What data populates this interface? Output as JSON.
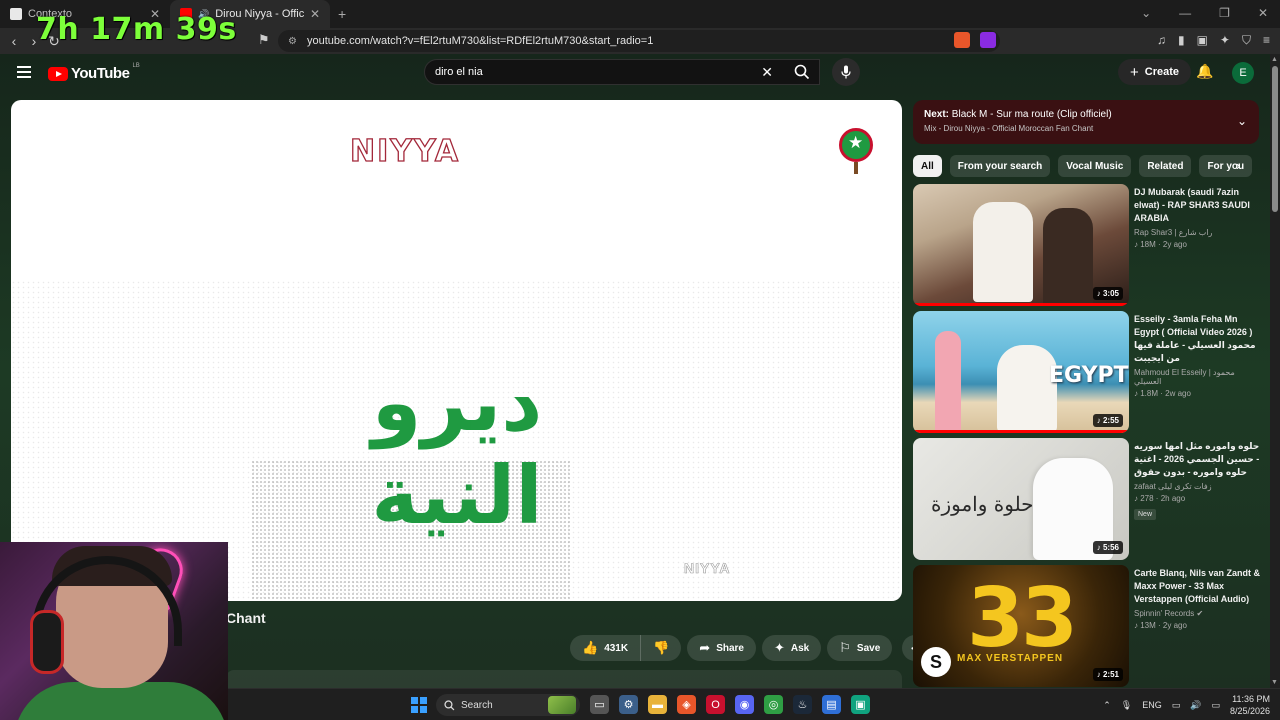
{
  "overlay": {
    "timer": "7h 17m 39s"
  },
  "browser": {
    "tabs": [
      {
        "label": "Contexto",
        "close": "✕"
      },
      {
        "label": "Dirou Niyya - Official Morocc",
        "close": "✕"
      }
    ],
    "new_tab": "+",
    "window_controls": {
      "chevron": "⌄",
      "minimize": "—",
      "restore": "❐",
      "close": "✕"
    },
    "nav": {
      "back": "‹",
      "forward": "›",
      "reload": "↻"
    },
    "url": "youtube.com/watch?v=fEl2rtuM730&list=RDfEl2rtuM730&start_radio=1"
  },
  "youtube": {
    "logo_text": "YouTube",
    "region": "LB",
    "search": {
      "value": "diro el nia",
      "clear": "✕"
    },
    "create_label": "Create",
    "avatar_letter": "E",
    "player": {
      "top_logo": "NIYYA",
      "arabic_title": "ديرو النية",
      "bottom_logo": "NIYYA"
    },
    "video_title_fragment": "Chant",
    "actions": {
      "likes": "431K",
      "share": "Share",
      "ask": "Ask",
      "save": "Save",
      "more": "•••"
    },
    "up_next": {
      "prefix": "Next:",
      "title": "Black M - Sur ma route (Clip officiel)",
      "mix": "Mix - Dirou Niyya - Official Moroccan Fan Chant"
    },
    "chips": [
      "All",
      "From your search",
      "Vocal Music",
      "Related",
      "For you"
    ],
    "recommendations": [
      {
        "title": "DJ Mubarak (saudi 7azin elwat) - RAP SHAR3 SAUDI ARABIA",
        "channel": "Rap Shar3 | راب شارع",
        "meta": "18M · 2y ago",
        "duration": "3:05"
      },
      {
        "title": "Esseily - 3amla Feha Mn Egypt ( Official Video 2026 ) محمود العسيلي - عاملة فيها من ايجيبت",
        "channel": "Mahmoud El Esseily | محمود العسيلي",
        "meta": "1.8M · 2w ago",
        "duration": "2:55",
        "thumb_text": "EGYPT"
      },
      {
        "title": "حلوه واموره مثل امها سوريه - حسين الجسمي 2026 - اغنية حلوه واموره - بدون حقوق",
        "channel": "zafaat زفات تكرى ليلى",
        "meta": "278 · 2h ago",
        "badge": "New",
        "duration": "5:56",
        "thumb_text": "حلوة واموزة"
      },
      {
        "title": "Carte Blanq, Nils van Zandt & Maxx Power - 33 Max Verstappen (Official Audio)",
        "channel": "Spinnin' Records",
        "meta": "13M · 2y ago",
        "duration": "2:51",
        "thumb_number": "33",
        "thumb_text": "MAX VERSTAPPEN"
      }
    ]
  },
  "taskbar": {
    "search_label": "Search",
    "language": "ENG",
    "time": "11:36 PM",
    "date": "8/25/2026"
  },
  "colors": {
    "accent_green": "#1f9a41",
    "niyya_red": "#a3283a",
    "yt_red": "#ff0000",
    "upnext_bg": "#3a1012"
  }
}
